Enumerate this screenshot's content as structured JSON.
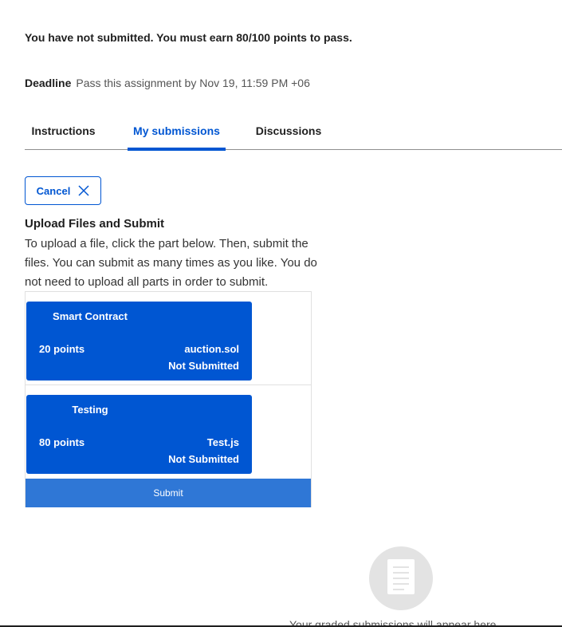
{
  "status_message": "You have not submitted. You must earn 80/100 points to pass.",
  "deadline": {
    "label": "Deadline",
    "text": "Pass this assignment by Nov 19, 11:59 PM +06"
  },
  "tabs": [
    {
      "label": "Instructions",
      "active": false
    },
    {
      "label": "My submissions",
      "active": true
    },
    {
      "label": "Discussions",
      "active": false
    }
  ],
  "cancel_button": {
    "label": "Cancel",
    "icon": "close-icon"
  },
  "upload": {
    "title": "Upload Files and Submit",
    "description": "To upload a file, click the part below. Then, submit the files. You can submit as many times as you like. You do not need to upload all parts in order to submit."
  },
  "parts": [
    {
      "title": "Smart Contract",
      "points": "20 points",
      "file": "auction.sol",
      "status": "Not Submitted"
    },
    {
      "title": "Testing",
      "points": "80 points",
      "file": "Test.js",
      "status": "Not Submitted"
    }
  ],
  "submit_button": {
    "label": "Submit"
  },
  "empty_state": {
    "text": "Your graded submissions will appear here",
    "icon": "document-icon"
  },
  "colors": {
    "accent": "#0056d2",
    "submit": "#2f77d6",
    "placeholder_circle": "#e3e3e3"
  }
}
